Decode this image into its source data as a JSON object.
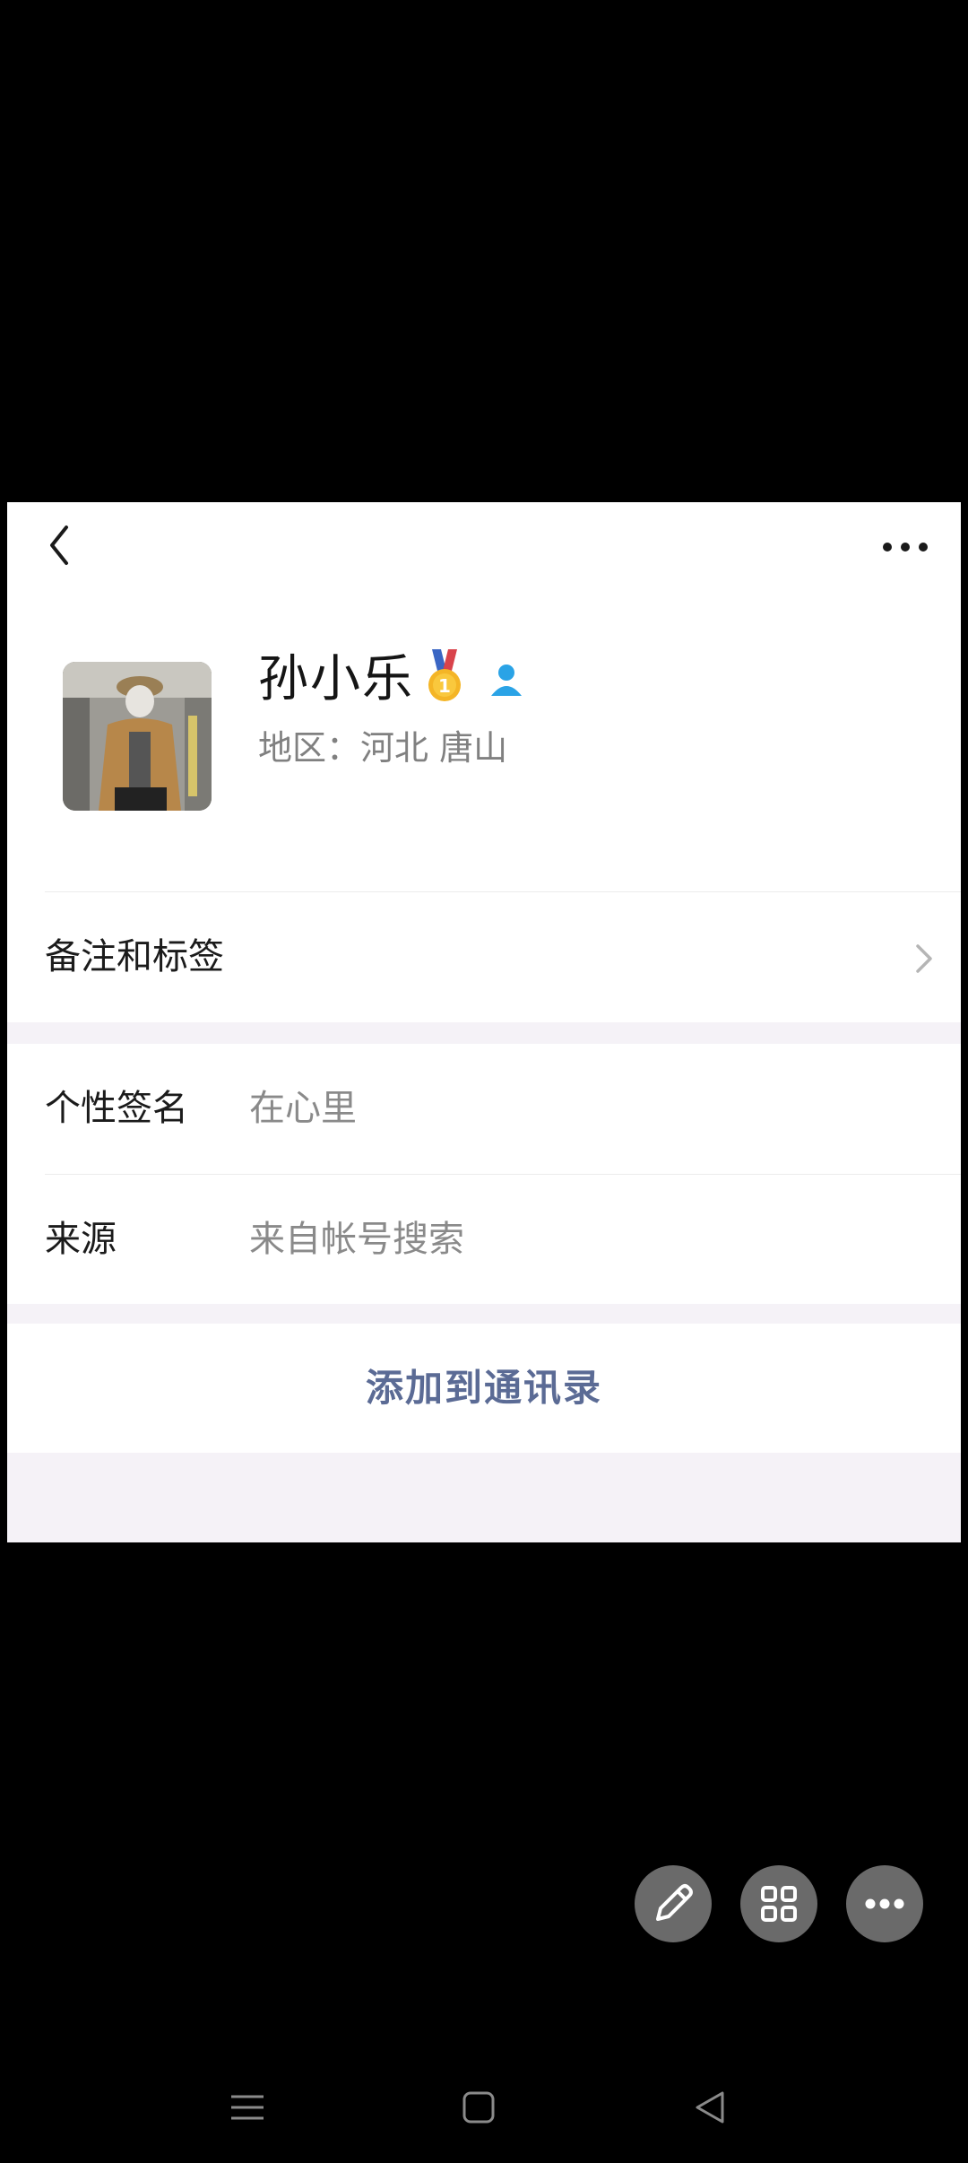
{
  "profile": {
    "name": "孙小乐",
    "region": "地区：河北 唐山"
  },
  "remark": {
    "label": "备注和标签"
  },
  "signature": {
    "label": "个性签名",
    "value": "在心里"
  },
  "source": {
    "label": "来源",
    "value": "来自帐号搜索"
  },
  "actions": {
    "add_contact": "添加到通讯录"
  },
  "icons": {
    "back": "back-arrow-icon",
    "more": "more-dots-icon",
    "medal": "gold-medal-icon",
    "user": "user-icon",
    "chevron": "chevron-right-icon",
    "edit": "pencil-icon",
    "grid": "grid-icon",
    "fab_more": "more-dots-icon",
    "nav_menu": "menu-icon",
    "nav_home": "home-square-icon",
    "nav_back": "back-triangle-icon"
  },
  "colors": {
    "accent_link": "#5b6b95",
    "background_gray": "#f5f2f7",
    "fab_gray": "#6a6a6a"
  }
}
